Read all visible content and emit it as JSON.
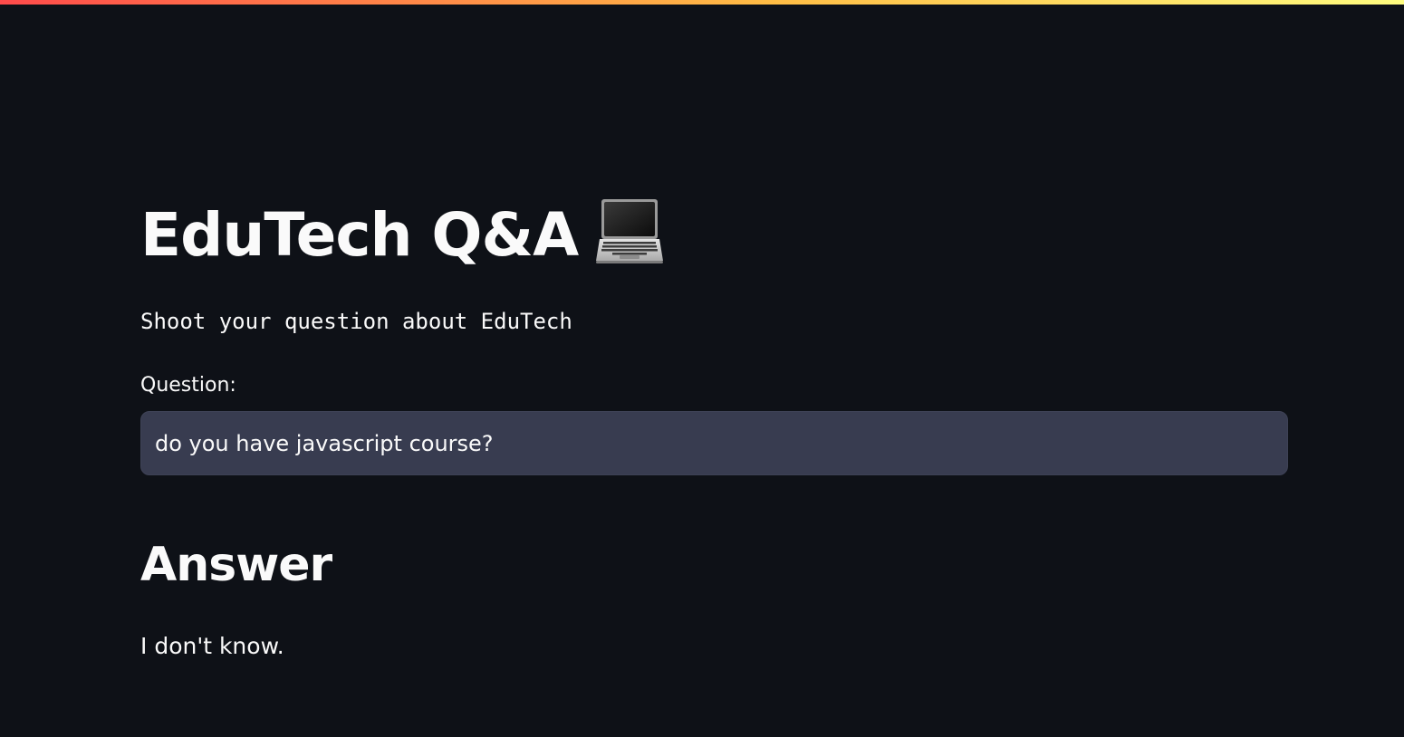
{
  "header": {
    "title": "EduTech Q&A",
    "title_icon": "laptop-icon",
    "subtitle": "Shoot your question about EduTech"
  },
  "question": {
    "label": "Question:",
    "value": "do you have javascript course?"
  },
  "answer": {
    "heading": "Answer",
    "text": "I don't know."
  },
  "colors": {
    "background": "#0e1117",
    "input_background": "#383c50",
    "text": "#fafafa",
    "accent_gradient_start": "#ff4b4b",
    "accent_gradient_end": "#fffd80"
  }
}
